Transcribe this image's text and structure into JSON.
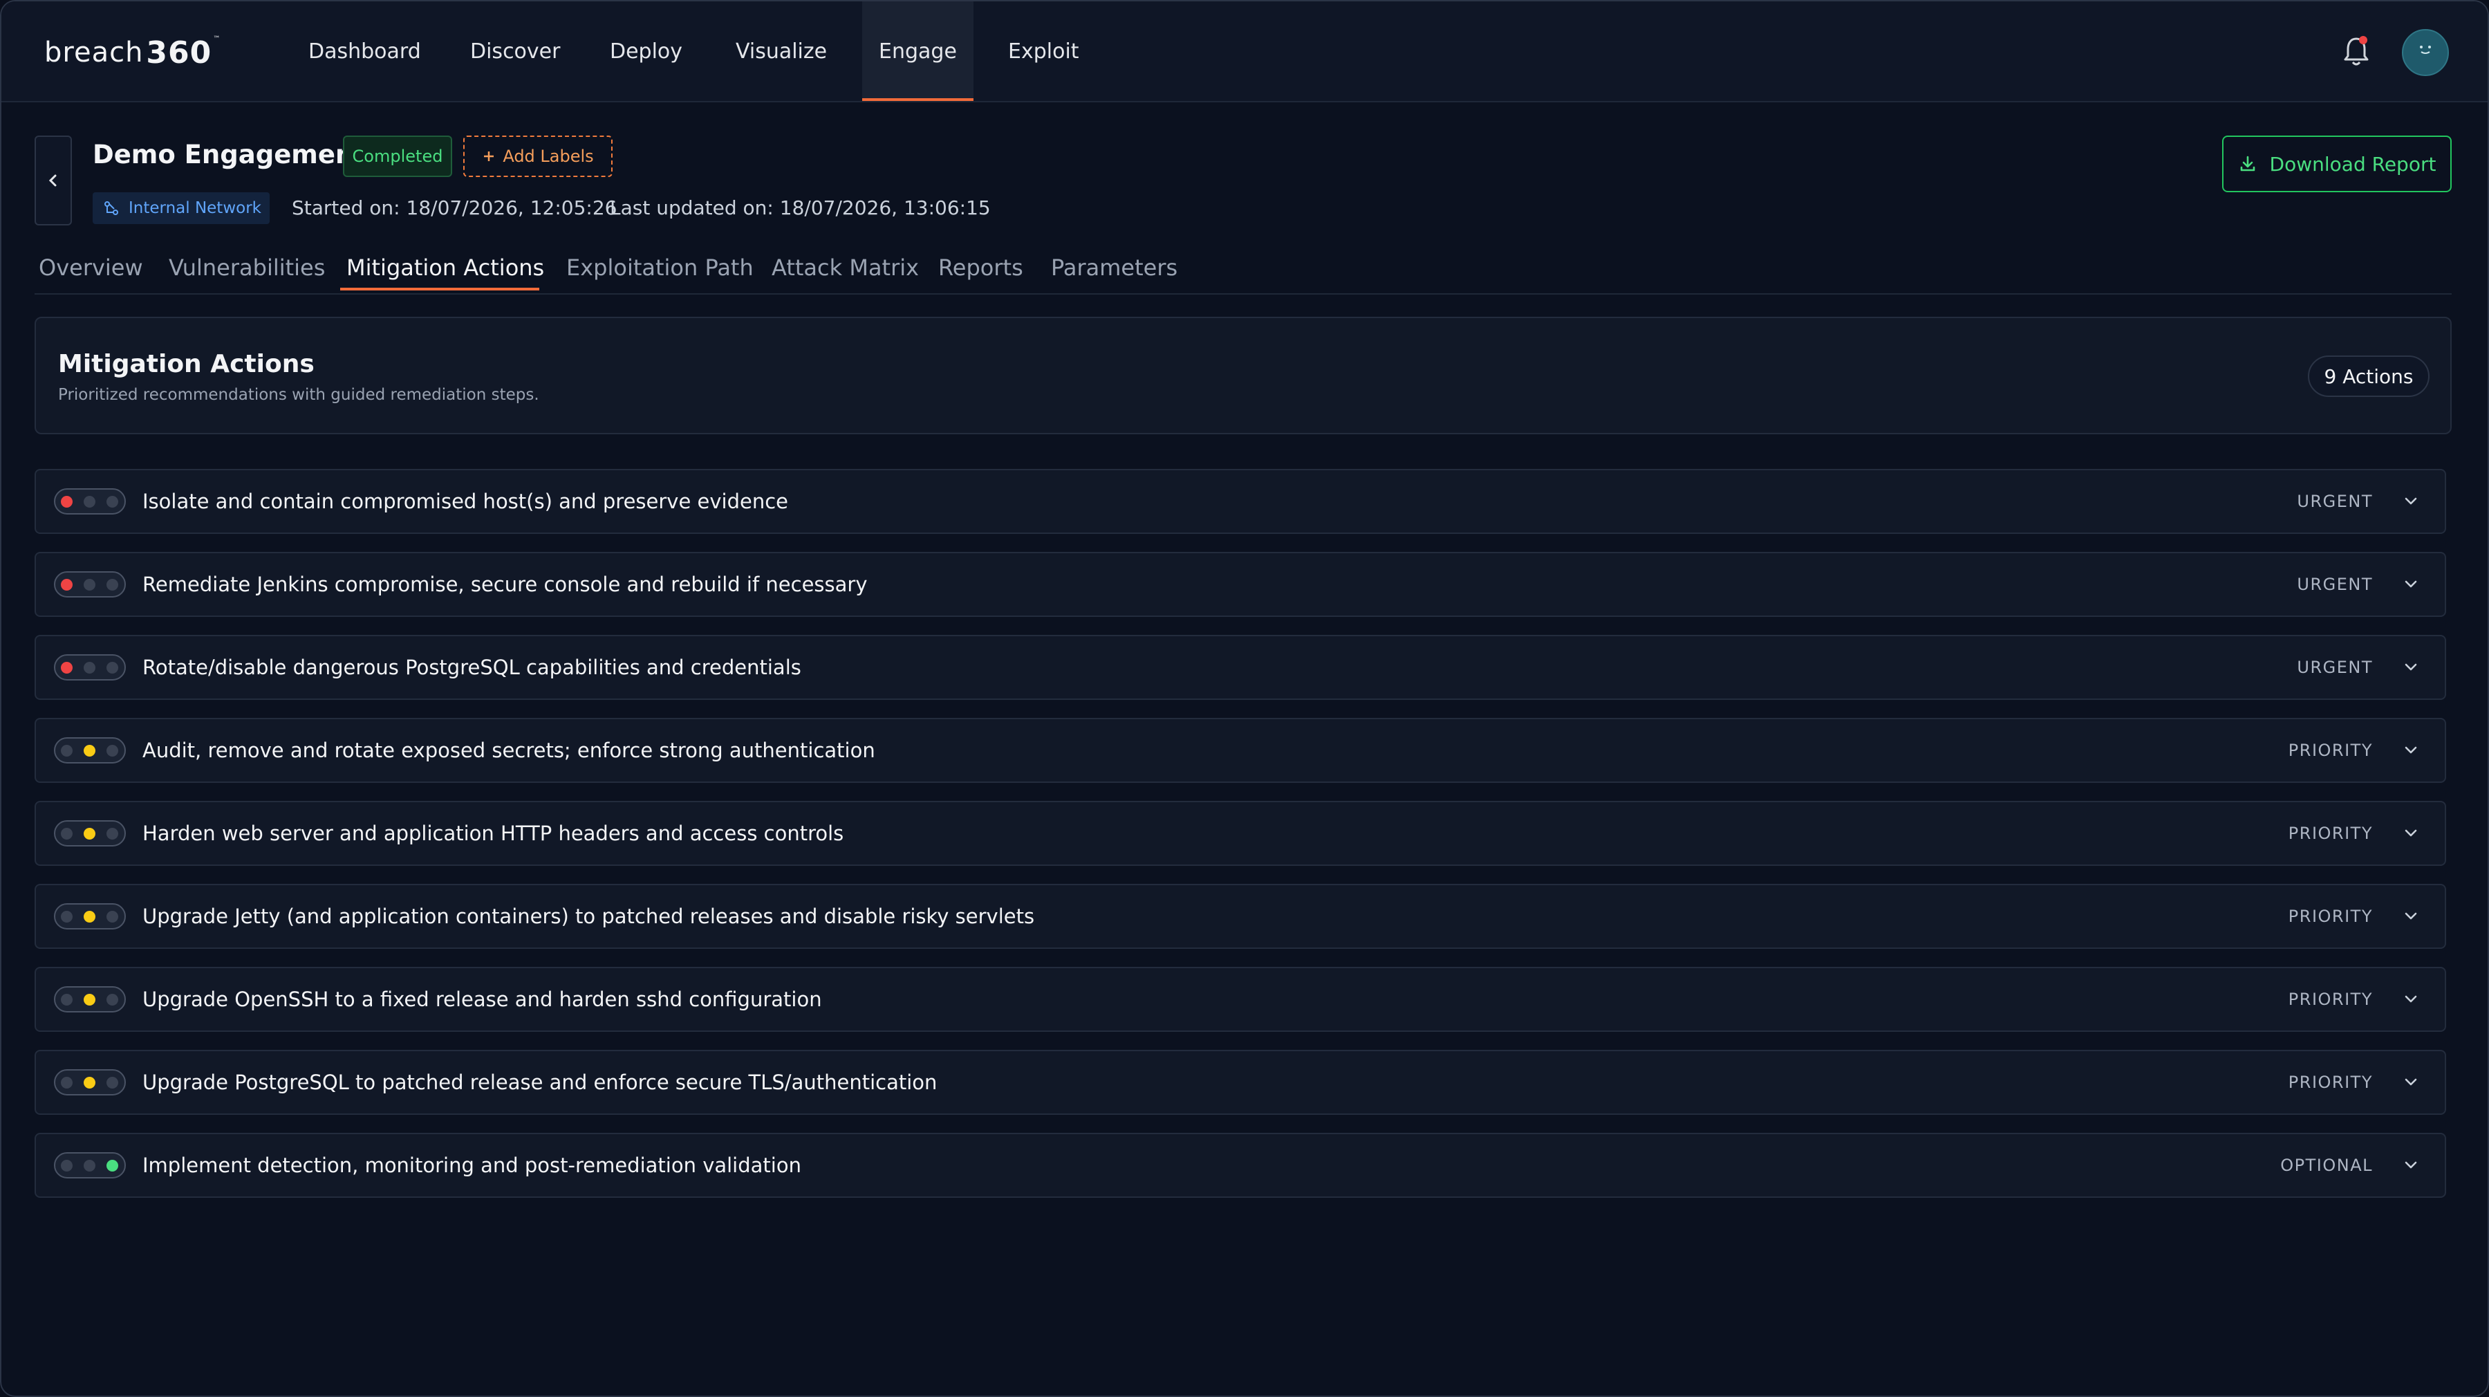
{
  "app": {
    "logo_word": "breach",
    "logo_num": "360",
    "logo_tm": "™"
  },
  "nav": {
    "items": [
      "Dashboard",
      "Discover",
      "Deploy",
      "Visualize",
      "Engage",
      "Exploit"
    ],
    "active": "Engage"
  },
  "header": {
    "title": "Demo Engagement",
    "status": "Completed",
    "add_labels": "Add Labels",
    "network": "Internal Network",
    "started": "Started on: 18/07/2026, 12:05:26",
    "updated": "Last updated on: 18/07/2026, 13:06:15",
    "download": "Download Report"
  },
  "tabs": {
    "items": [
      "Overview",
      "Vulnerabilities",
      "Mitigation Actions",
      "Exploitation Path",
      "Attack Matrix",
      "Reports",
      "Parameters"
    ],
    "active": "Mitigation Actions"
  },
  "mitigation": {
    "title": "Mitigation Actions",
    "subtitle": "Prioritized recommendations with guided remediation steps.",
    "count_label": "9 Actions",
    "actions": [
      {
        "text": "Isolate and contain compromised host(s) and preserve evidence",
        "level": "URGENT",
        "light": "red"
      },
      {
        "text": "Remediate Jenkins compromise, secure console and rebuild if necessary",
        "level": "URGENT",
        "light": "red"
      },
      {
        "text": "Rotate/disable dangerous PostgreSQL capabilities and credentials",
        "level": "URGENT",
        "light": "red"
      },
      {
        "text": "Audit, remove and rotate exposed secrets; enforce strong authentication",
        "level": "PRIORITY",
        "light": "yellow"
      },
      {
        "text": "Harden web server and application HTTP headers and access controls",
        "level": "PRIORITY",
        "light": "yellow"
      },
      {
        "text": "Upgrade Jetty (and application containers) to patched releases and disable risky servlets",
        "level": "PRIORITY",
        "light": "yellow"
      },
      {
        "text": "Upgrade OpenSSH to a fixed release and harden sshd configuration",
        "level": "PRIORITY",
        "light": "yellow"
      },
      {
        "text": "Upgrade PostgreSQL to patched release and enforce secure TLS/authentication",
        "level": "PRIORITY",
        "light": "yellow"
      },
      {
        "text": "Implement detection, monitoring and post-remediation validation",
        "level": "OPTIONAL",
        "light": "green"
      }
    ]
  },
  "colors": {
    "accent": "#f26b3a",
    "red": "#ef4444",
    "yellow": "#facc15",
    "green": "#4ade80",
    "success": "#22c55e"
  },
  "icons": {
    "bell": "bell-icon",
    "back": "chevron-left-icon",
    "download": "download-icon",
    "network": "network-icon",
    "expand": "chevron-down-icon",
    "plus": "plus-icon"
  }
}
